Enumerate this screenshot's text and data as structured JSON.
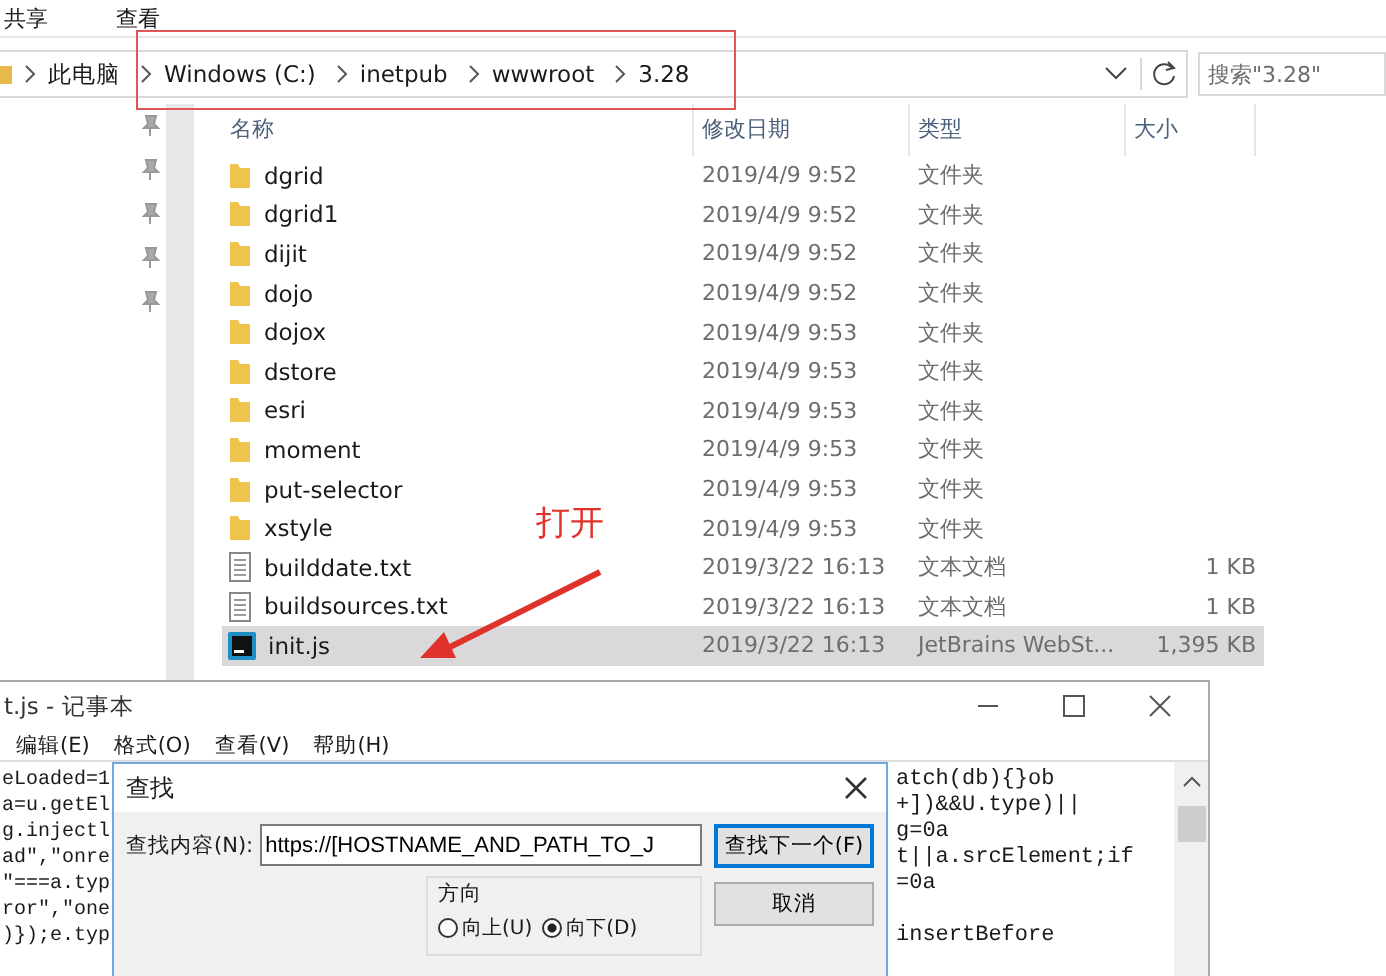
{
  "explorer": {
    "ribbon_tabs": [
      "共享",
      "查看"
    ],
    "breadcrumb": [
      "此电脑",
      "Windows (C:)",
      "inetpub",
      "wwwroot",
      "3.28"
    ],
    "search": {
      "placeholder": "搜索\"3.28\""
    },
    "columns": [
      "名称",
      "修改日期",
      "类型",
      "大小"
    ],
    "files": [
      {
        "kind": "folder",
        "name": "dgrid",
        "date": "2019/4/9 9:52",
        "type": "文件夹",
        "selected": false
      },
      {
        "kind": "folder",
        "name": "dgrid1",
        "date": "2019/4/9 9:52",
        "type": "文件夹",
        "selected": false
      },
      {
        "kind": "folder",
        "name": "dijit",
        "date": "2019/4/9 9:52",
        "type": "文件夹",
        "selected": false
      },
      {
        "kind": "folder",
        "name": "dojo",
        "date": "2019/4/9 9:52",
        "type": "文件夹",
        "selected": false
      },
      {
        "kind": "folder",
        "name": "dojox",
        "date": "2019/4/9 9:53",
        "type": "文件夹",
        "selected": false
      },
      {
        "kind": "folder",
        "name": "dstore",
        "date": "2019/4/9 9:53",
        "type": "文件夹",
        "selected": false
      },
      {
        "kind": "folder",
        "name": "esri",
        "date": "2019/4/9 9:53",
        "type": "文件夹",
        "selected": false
      },
      {
        "kind": "folder",
        "name": "moment",
        "date": "2019/4/9 9:53",
        "type": "文件夹",
        "selected": false
      },
      {
        "kind": "folder",
        "name": "put-selector",
        "date": "2019/4/9 9:53",
        "type": "文件夹",
        "selected": false
      },
      {
        "kind": "folder",
        "name": "xstyle",
        "date": "2019/4/9 9:53",
        "type": "文件夹",
        "selected": false
      },
      {
        "kind": "text",
        "name": "builddate.txt",
        "date": "2019/3/22 16:13",
        "type": "文本文档",
        "size": "1 KB",
        "selected": false
      },
      {
        "kind": "text",
        "name": "buildsources.txt",
        "date": "2019/3/22 16:13",
        "type": "文本文档",
        "size": "1 KB",
        "selected": false
      },
      {
        "kind": "script",
        "name": "init.js",
        "date": "2019/3/22 16:13",
        "type": "JetBrains WebSt...",
        "size": "1,395 KB",
        "selected": true
      }
    ]
  },
  "annotation": {
    "text": "打开"
  },
  "notepad": {
    "title": "t.js - 记事本",
    "menu": [
      "编辑(E)",
      "格式(O)",
      "查看(V)",
      "帮助(H)"
    ],
    "code_left": [
      "eLoaded=1",
      "a=u.getEl",
      "g.injectl",
      "ad\",\"onre",
      "\"===a.typ",
      "ror\",\"one",
      ")});e.typ"
    ],
    "code_right": [
      {
        "kind": "code",
        "text": "atch(db){}ob"
      },
      {
        "kind": "code",
        "text": "+])&&U.type)||"
      },
      {
        "kind": "code",
        "text": "g=0a"
      },
      {
        "kind": "code",
        "text": "t||a.srcElement;if"
      },
      {
        "kind": "code",
        "text": "=0a"
      },
      {
        "kind": "blank"
      },
      {
        "kind": "code",
        "text": "insertBefore"
      }
    ]
  },
  "find_dialog": {
    "title": "查找",
    "find_label": "查找内容(N):",
    "find_value": "https://[HOSTNAME_AND_PATH_TO_J",
    "buttons": [
      {
        "label": "查找下一个(F)",
        "default": true
      },
      {
        "label": "取消",
        "default": false
      }
    ],
    "direction": {
      "title": "方向",
      "options": [
        {
          "label": "向上(U)",
          "selected": false
        },
        {
          "label": "向下(D)",
          "selected": true
        }
      ]
    }
  }
}
